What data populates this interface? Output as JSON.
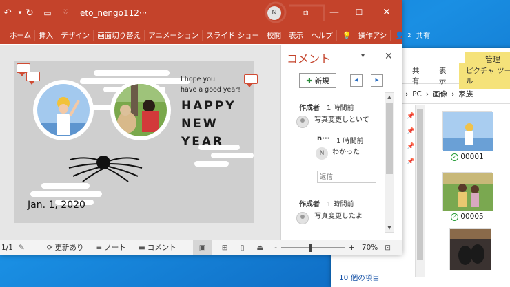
{
  "ppt": {
    "title": "eto_nengo112···",
    "user_initial": "N",
    "ribbon_tabs": [
      "ホーム",
      "挿入",
      "デザイン",
      "画面切り替え",
      "アニメーション",
      "スライド ショー",
      "校閲",
      "表示",
      "ヘルプ",
      "操作アシ",
      "2",
      "共有"
    ],
    "search_label": "操作アシ",
    "share_count": "2",
    "share_label": "共有"
  },
  "slide": {
    "greeting_line1": "I hope you",
    "greeting_line2": "have a good year!",
    "happy": "HAPPY",
    "new": "NEW",
    "year": "YEAR",
    "date": "Jan. 1, 2020"
  },
  "comments": {
    "title": "コメント",
    "new_button": "新規",
    "thread1": {
      "author": "作成者",
      "time": "1 時間前",
      "text": "写真変更しといて",
      "reply": {
        "author": "n···",
        "avatar": "N",
        "time": "1 時間前",
        "text": "わかった"
      },
      "reply_placeholder": "返信..."
    },
    "thread2": {
      "author": "作成者",
      "time": "1 時間前",
      "text": "写真変更したよ"
    }
  },
  "status": {
    "page": "1/1",
    "update": "更新あり",
    "notes": "ノート",
    "comments": "コメント",
    "zoom": "70%",
    "zoom_level": 0.45,
    "minus": "-",
    "plus": "+"
  },
  "explorer": {
    "manage_tab": "管理",
    "tabs": [
      "共有",
      "表示",
      "ピクチャ ツール"
    ],
    "path": [
      "PC",
      "画像",
      "家族"
    ],
    "truncated_label": "ス",
    "files": [
      {
        "name": "00001"
      },
      {
        "name": "00005"
      }
    ],
    "status": "10 個の項目"
  },
  "colors": {
    "accent": "#c4432b",
    "explorer_ctx": "#f5e27a"
  }
}
